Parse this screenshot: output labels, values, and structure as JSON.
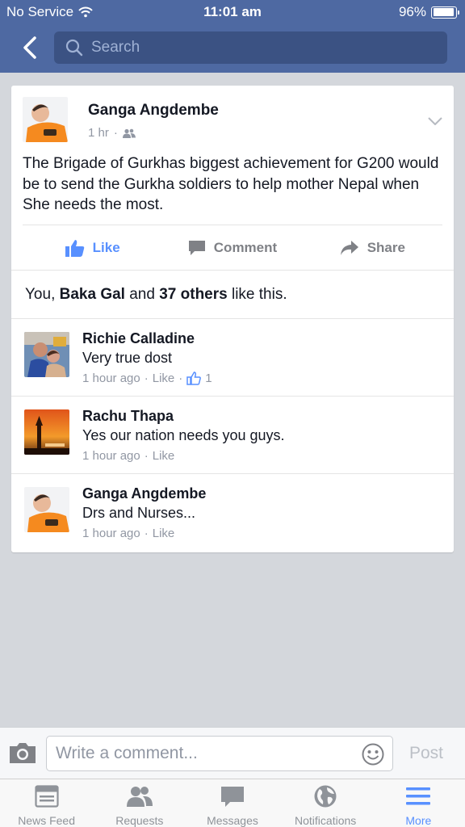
{
  "status_bar": {
    "carrier": "No Service",
    "time": "11:01 am",
    "battery": "96%",
    "battery_level": 0.96
  },
  "header": {
    "search_placeholder": "Search"
  },
  "post": {
    "author": "Ganga Angdembe",
    "time": "1 hr",
    "text": "The Brigade of Gurkhas biggest achievement for G200 would be to send the Gurkha soldiers to help mother Nepal when She needs the most.",
    "actions": {
      "like": "Like",
      "comment": "Comment",
      "share": "Share"
    },
    "likes": {
      "prefix": "You, ",
      "name": "Baka Gal",
      "middle": " and ",
      "others": "37 others",
      "suffix": " like this."
    }
  },
  "comments": [
    {
      "author": "Richie Calladine",
      "text": "Very true dost",
      "time": "1 hour ago",
      "like_label": "Like",
      "like_count": "1"
    },
    {
      "author": "Rachu Thapa",
      "text": "Yes our nation needs you guys.",
      "time": "1 hour ago",
      "like_label": "Like"
    },
    {
      "author": "Ganga Angdembe",
      "text": "Drs and Nurses...",
      "time": "1 hour ago",
      "like_label": "Like"
    }
  ],
  "composer": {
    "placeholder": "Write a comment...",
    "post_label": "Post"
  },
  "tabs": [
    {
      "label": "News Feed",
      "icon": "news-feed-icon"
    },
    {
      "label": "Requests",
      "icon": "requests-icon"
    },
    {
      "label": "Messages",
      "icon": "messages-icon"
    },
    {
      "label": "Notifications",
      "icon": "globe-icon"
    },
    {
      "label": "More",
      "icon": "menu-icon",
      "active": true
    }
  ],
  "colors": {
    "brand": "#4e69a2",
    "accent": "#5890ff",
    "background": "#d4d7dc",
    "muted": "#9197a3"
  }
}
